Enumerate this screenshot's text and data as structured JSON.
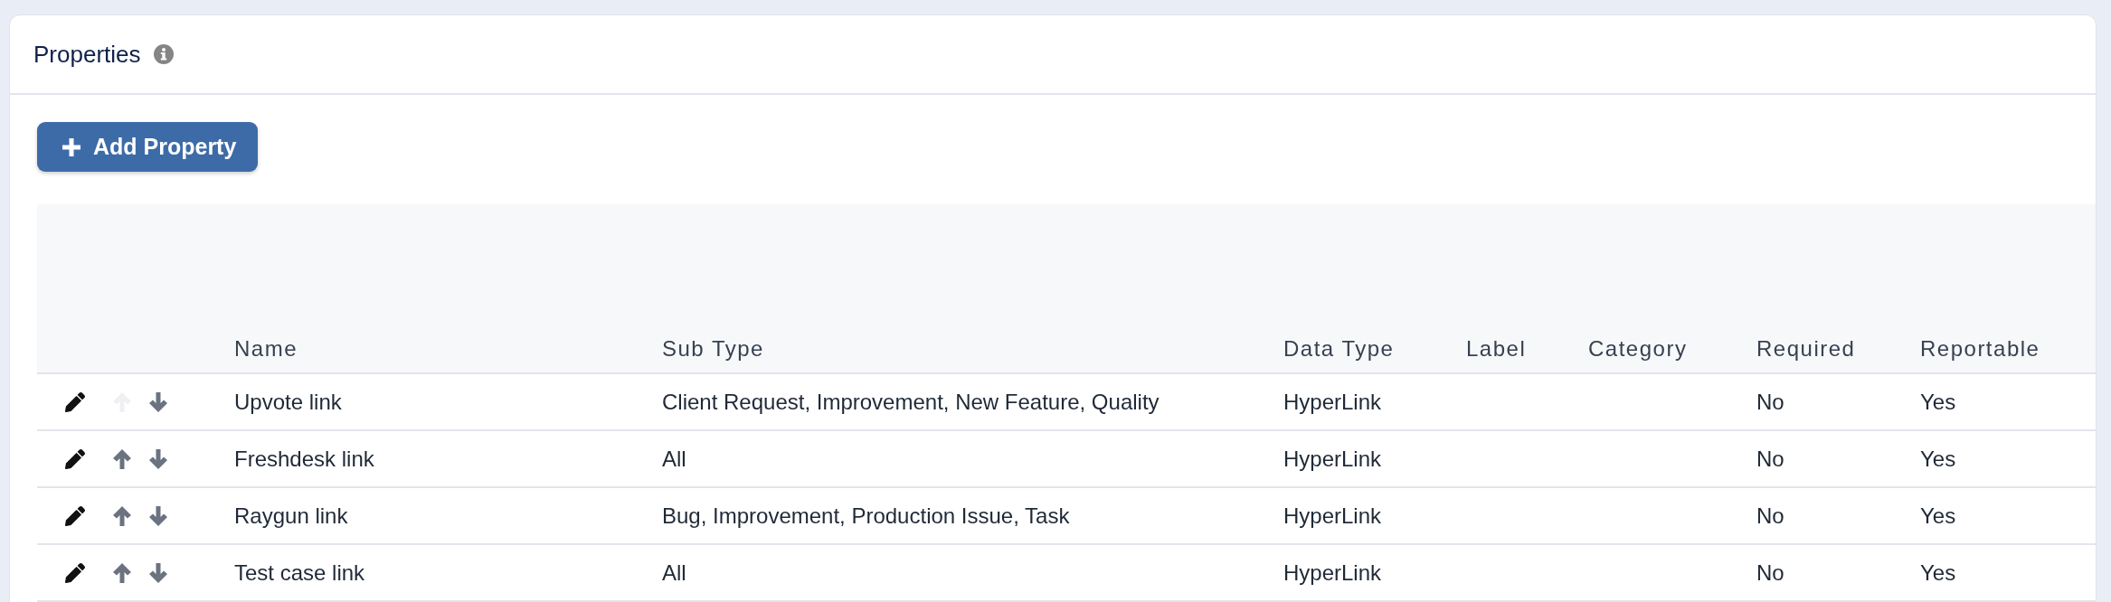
{
  "panel": {
    "title": "Properties"
  },
  "add_button": {
    "label": "Add Property"
  },
  "table": {
    "columns": [
      "Name",
      "Sub Type",
      "Data Type",
      "Label",
      "Category",
      "Required",
      "Reportable"
    ],
    "rows": [
      {
        "can_move_up": false,
        "cells": [
          "Upvote link",
          "Client Request, Improvement, New Feature, Quality",
          "HyperLink",
          "",
          "",
          "No",
          "Yes"
        ]
      },
      {
        "can_move_up": true,
        "cells": [
          "Freshdesk link",
          "All",
          "HyperLink",
          "",
          "",
          "No",
          "Yes"
        ]
      },
      {
        "can_move_up": true,
        "cells": [
          "Raygun link",
          "Bug, Improvement, Production Issue, Task",
          "HyperLink",
          "",
          "",
          "No",
          "Yes"
        ]
      },
      {
        "can_move_up": true,
        "cells": [
          "Test case link",
          "All",
          "HyperLink",
          "",
          "",
          "No",
          "Yes"
        ]
      }
    ]
  }
}
